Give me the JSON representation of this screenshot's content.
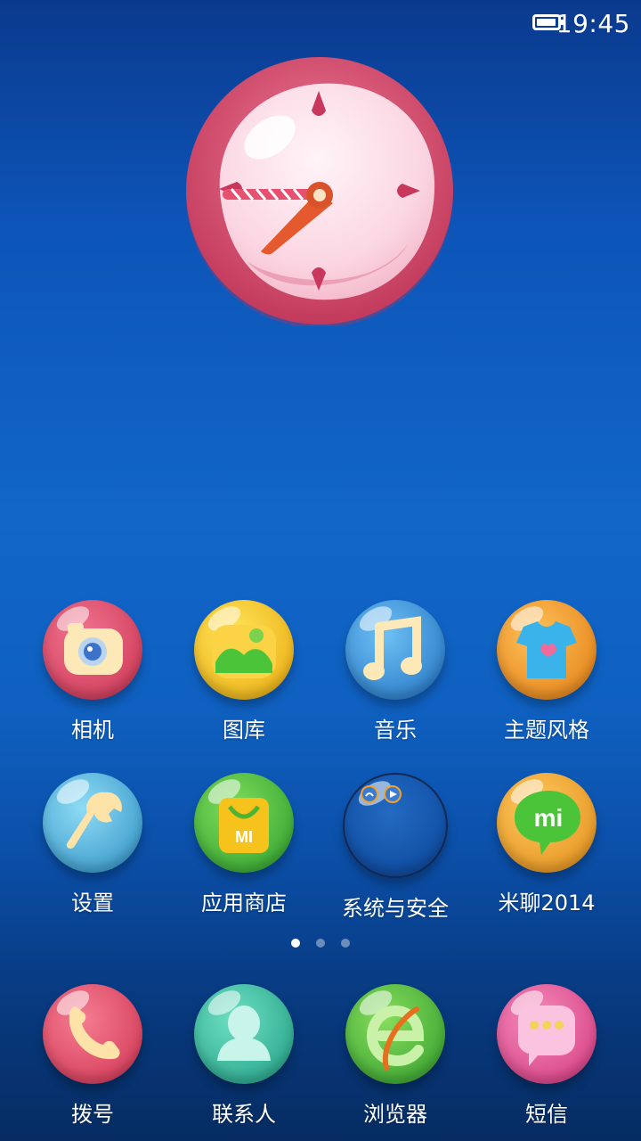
{
  "status_bar": {
    "time": "19:45",
    "battery_level": 0.95
  },
  "clock_widget": {
    "icon": "analog-clock-icon"
  },
  "apps": [
    {
      "label": "相机",
      "icon": "camera-icon",
      "color": "#d9415d"
    },
    {
      "label": "图库",
      "icon": "gallery-icon",
      "color": "#f3c21b"
    },
    {
      "label": "音乐",
      "icon": "music-icon",
      "color": "#2e8ed8"
    },
    {
      "label": "主题风格",
      "icon": "theme-shirt-icon",
      "color": "#f09a2c"
    },
    {
      "label": "设置",
      "icon": "settings-wrench-icon",
      "color": "#39a6d6"
    },
    {
      "label": "应用商店",
      "icon": "app-store-bag-icon",
      "color": "#43b63a"
    },
    {
      "label": "系统与安全",
      "icon": "system-security-folder-icon",
      "color": "#1a5bb5"
    },
    {
      "label": "米聊2014",
      "icon": "mi-chat-icon",
      "color": "#f0a22b"
    }
  ],
  "page_indicator": {
    "pages": 3,
    "active": 0
  },
  "dock": [
    {
      "label": "拨号",
      "icon": "phone-icon",
      "color": "#e25066"
    },
    {
      "label": "联系人",
      "icon": "contacts-icon",
      "color": "#34c4a5"
    },
    {
      "label": "浏览器",
      "icon": "browser-icon",
      "color": "#46b839"
    },
    {
      "label": "短信",
      "icon": "message-icon",
      "color": "#e24b8c"
    }
  ]
}
